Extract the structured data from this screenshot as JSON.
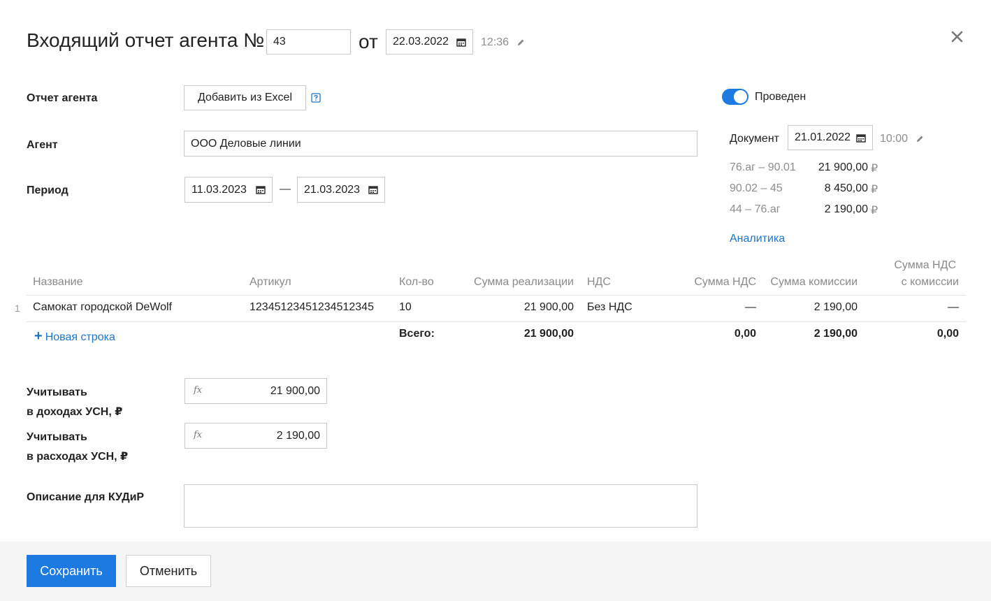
{
  "header": {
    "title": "Входящий отчет агента №",
    "number_value": "43",
    "from_label": "от",
    "date_value": "22.03.2022",
    "time_value": "12:36"
  },
  "form": {
    "report_label": "Отчет агента",
    "excel_button_label": "Добавить из Excel",
    "agent_label": "Агент",
    "agent_value": "ООО Деловые линии",
    "period_label": "Период",
    "period_from": "11.03.2023",
    "period_dash": "—",
    "period_to": "21.03.2023"
  },
  "posting": {
    "status_label": "Проведен",
    "toggle_on": true,
    "document_label": "Документ",
    "document_date": "21.01.2022",
    "document_time": "10:00",
    "entries": [
      {
        "accounts": "76.аг – 90.01",
        "amount": "21 900,00",
        "currency": "₽"
      },
      {
        "accounts": "90.02 – 45",
        "amount": "8 450,00",
        "currency": "₽"
      },
      {
        "accounts": "44 – 76.аг",
        "amount": "2 190,00",
        "currency": "₽"
      }
    ],
    "analytics_link": "Аналитика"
  },
  "table": {
    "columns": [
      "Название",
      "Артикул",
      "Кол-во",
      "Сумма реализации",
      "НДС",
      "Сумма НДС",
      "Сумма комиссии",
      "Сумма НДС",
      "с комиссии"
    ],
    "rows": [
      {
        "index": "1",
        "name": "Самокат городской DeWolf",
        "article": "12345123451234512345",
        "qty": "10",
        "sale_sum": "21 900,00",
        "vat": "Без НДС",
        "vat_sum": "—",
        "commission": "2 190,00",
        "vat_commission": "—"
      }
    ],
    "new_row_label": "Новая строка",
    "total_label": "Всего:",
    "totals": {
      "sale_sum": "21 900,00",
      "vat_sum": "0,00",
      "commission": "2 190,00",
      "vat_commission": "0,00"
    }
  },
  "usn": {
    "income_label_1": "Учитывать",
    "income_label_2": "в доходах УСН, ₽",
    "income_value": "21 900,00",
    "expense_label_1": "Учитывать",
    "expense_label_2": "в расходах УСН, ₽",
    "expense_value": "2 190,00",
    "fx_symbol": "fx"
  },
  "kudir": {
    "label": "Описание для КУДиР",
    "value": ""
  },
  "footer": {
    "save_label": "Сохранить",
    "cancel_label": "Отменить"
  },
  "colors": {
    "accent": "#1e74c9",
    "toggle": "#1d7ae0",
    "save_button": "#1d7ae0"
  }
}
